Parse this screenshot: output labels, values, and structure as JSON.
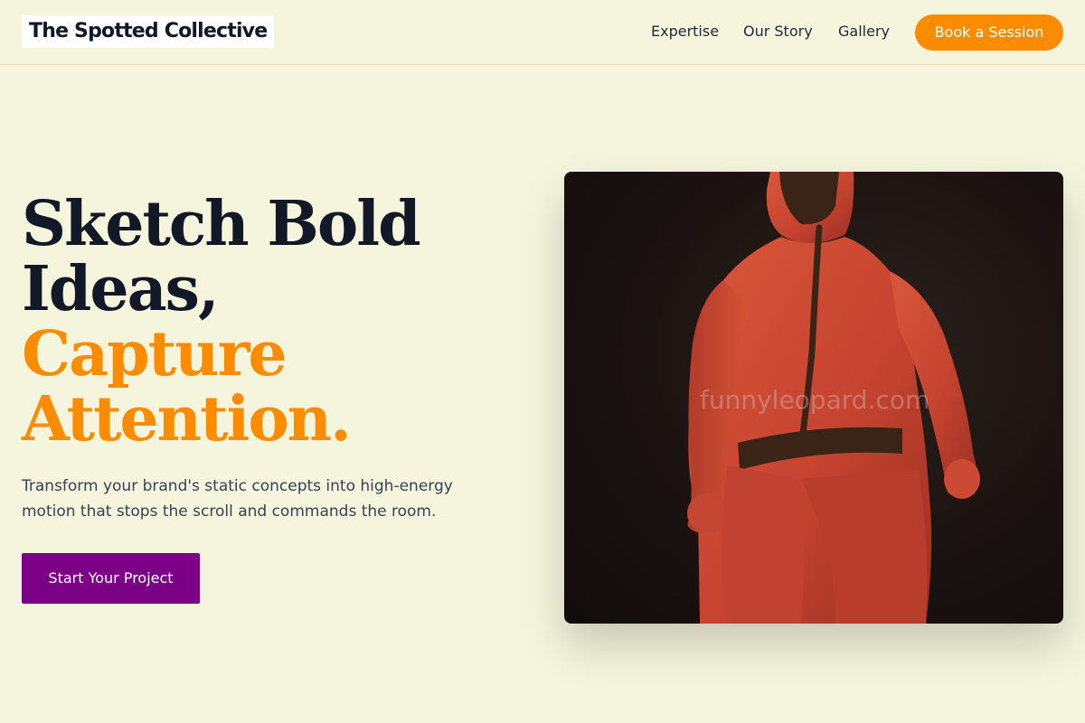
{
  "header": {
    "logo": "The Spotted Collective",
    "nav": [
      "Expertise",
      "Our Story",
      "Gallery"
    ],
    "cta_label": "Book a Session"
  },
  "hero": {
    "title_line1": "Sketch Bold",
    "title_line2": "Ideas,",
    "title_accent_line1": "Capture",
    "title_accent_line2": "Attention.",
    "description": "Transform your brand's static concepts into high-energy motion that stops the scroll and commands the room.",
    "cta_label": "Start Your Project",
    "image_watermark": "funnyleopard.com"
  },
  "colors": {
    "background": "#f5f4dc",
    "accent": "#fb8c00",
    "cta": "#7b0085",
    "heading": "#111827"
  }
}
